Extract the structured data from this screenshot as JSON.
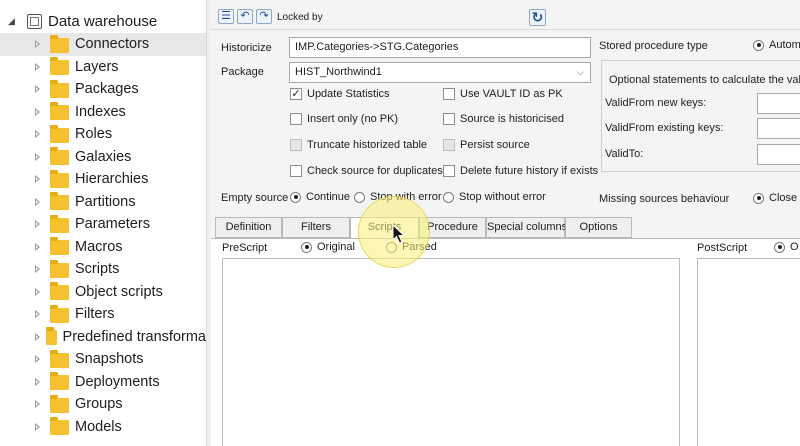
{
  "tree": {
    "root_label": "Data warehouse",
    "items": [
      {
        "label": "Connectors",
        "selected": true
      },
      {
        "label": "Layers"
      },
      {
        "label": "Packages"
      },
      {
        "label": "Indexes"
      },
      {
        "label": "Roles"
      },
      {
        "label": "Galaxies"
      },
      {
        "label": "Hierarchies"
      },
      {
        "label": "Partitions"
      },
      {
        "label": "Parameters"
      },
      {
        "label": "Macros"
      },
      {
        "label": "Scripts"
      },
      {
        "label": "Object scripts"
      },
      {
        "label": "Filters"
      },
      {
        "label": "Predefined transforma"
      },
      {
        "label": "Snapshots"
      },
      {
        "label": "Deployments"
      },
      {
        "label": "Groups"
      },
      {
        "label": "Models"
      }
    ]
  },
  "toolbar": {
    "locked_by_label": "Locked by"
  },
  "form": {
    "historicize_label": "Historicize",
    "historicize_value": "IMP.Categories->STG.Categories",
    "package_label": "Package",
    "package_value": "HIST_Northwind1",
    "checkboxes": {
      "update_statistics": {
        "label": "Update Statistics",
        "checked": true
      },
      "use_vault_id": {
        "label": "Use VAULT ID as PK",
        "checked": false
      },
      "insert_only": {
        "label": "Insert only (no PK)",
        "checked": false
      },
      "source_historicised": {
        "label": "Source is historicised",
        "checked": false
      },
      "truncate_historized": {
        "label": "Truncate historized table",
        "checked": false
      },
      "persist_source": {
        "label": "Persist source",
        "checked": false
      },
      "check_duplicates": {
        "label": "Check source for duplicates",
        "checked": false
      },
      "delete_future_history": {
        "label": "Delete future history if exists",
        "checked": false
      }
    },
    "empty_source_label": "Empty source",
    "empty_source_options": [
      {
        "label": "Continue",
        "selected": true
      },
      {
        "label": "Stop with error",
        "selected": false
      },
      {
        "label": "Stop without error",
        "selected": false
      }
    ],
    "stored_procedure_type_label": "Stored procedure type",
    "stored_procedure_type_option": "Autom",
    "optional_group_title": "Optional statements to calculate the validi",
    "valid_from_new_label": "ValidFrom new keys:",
    "valid_from_existing_label": "ValidFrom existing keys:",
    "valid_to_label": "ValidTo:",
    "missing_sources_label": "Missing sources behaviour",
    "missing_sources_option": "Close"
  },
  "tabs": [
    "Definition",
    "Filters",
    "Scripts",
    "Procedure",
    "Special columns",
    "Options"
  ],
  "active_tab": "Scripts",
  "scripts_panel": {
    "prescript_label": "PreScript",
    "prescript_mode_original": "Original",
    "prescript_mode_parsed": "Parsed",
    "postscript_label": "PostScript",
    "postscript_mode_original": "O"
  },
  "colors": {
    "folder": "#f5c12e",
    "toolbar_icon": "#1d4f91",
    "cursor_highlight": "#faf078"
  }
}
